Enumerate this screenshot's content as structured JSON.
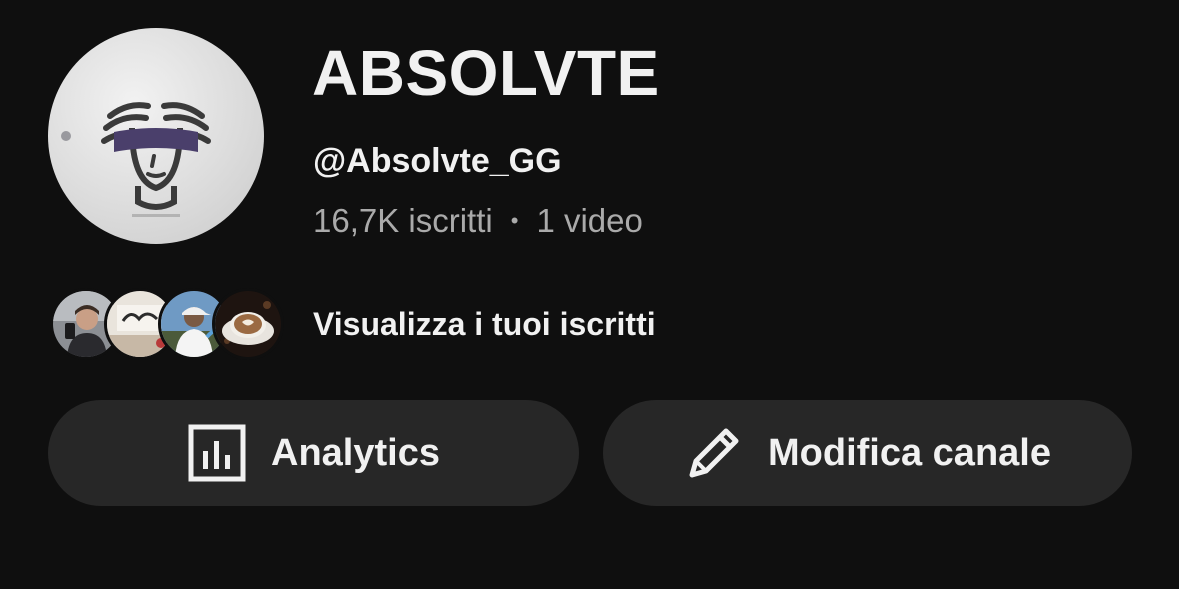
{
  "channel": {
    "name": "ABSOLVTE",
    "handle": "@Absolvte_GG",
    "subscribers": "16,7K iscritti",
    "separator": "•",
    "videos": "1 video",
    "avatar_icon": "blindfolded-justice-logo"
  },
  "subscribers_preview": {
    "link_label": "Visualizza i tuoi iscritti",
    "avatars": [
      "avatar-person-photo",
      "avatar-sign-photo",
      "avatar-cap-photo",
      "avatar-coffee-photo"
    ]
  },
  "actions": {
    "analytics": {
      "label": "Analytics",
      "icon": "bar-chart-icon"
    },
    "edit": {
      "label": "Modifica canale",
      "icon": "pencil-icon"
    }
  },
  "colors": {
    "background": "#0f0f0f",
    "button_background": "#272727",
    "primary_text": "#f1f1f1",
    "secondary_text": "#aaaaaa",
    "logo_blindfold": "#4a3f6b"
  }
}
